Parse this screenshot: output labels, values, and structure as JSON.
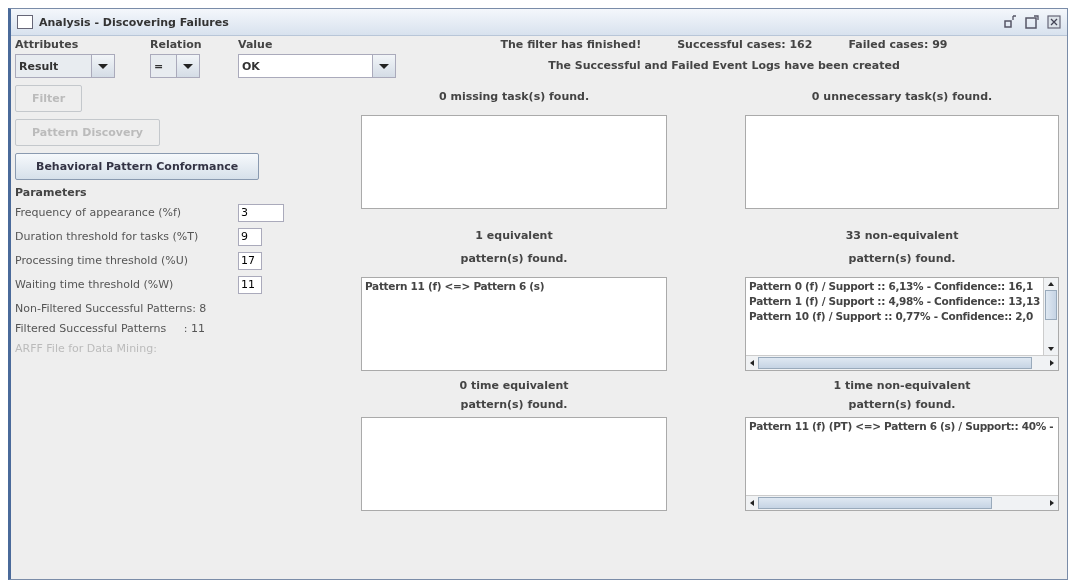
{
  "window": {
    "title": "Analysis - Discovering Failures"
  },
  "filter": {
    "columns": [
      "Attributes",
      "Relation",
      "Value"
    ],
    "dropdowns": [
      {
        "kind": "attribute",
        "value": "Result"
      },
      {
        "kind": "relation",
        "value": "="
      },
      {
        "kind": "value",
        "value": "OK"
      }
    ]
  },
  "buttons": [
    {
      "label": "Filter",
      "disabled": true
    },
    {
      "label": "Pattern Discovery",
      "disabled": true
    },
    {
      "label": "Behavioral Pattern Conformance",
      "disabled": false
    }
  ],
  "parameters": {
    "title": "Parameters",
    "fields": [
      {
        "label": "Frequency of appearance (%f)",
        "value": "3",
        "kind": "wide"
      },
      {
        "label": "Duration threshold for tasks (%T)",
        "value": "9",
        "kind": "narrow"
      },
      {
        "label": "Processing time threshold (%U)",
        "value": "17",
        "kind": "narrow"
      },
      {
        "label": "Waiting time threshold (%W)",
        "value": "11",
        "kind": "narrow"
      }
    ],
    "stats": [
      {
        "label": "Non-Filtered Successful Patterns: 8",
        "disabled": false
      },
      {
        "label": "Filtered Successful Patterns     : 11",
        "disabled": false
      },
      {
        "label": "ARFF File for Data Mining:",
        "disabled": true
      }
    ]
  },
  "status": {
    "lines": [
      [
        "The filter has finished!",
        "Successful cases: 162",
        "Failed cases: 99"
      ],
      [
        "The Successful and Failed Event Logs have been created"
      ]
    ]
  },
  "results": [
    {
      "heading": [
        "0 missing task(s) found."
      ],
      "kind": "plain"
    },
    {
      "heading": [
        "0 unnecessary task(s) found."
      ],
      "kind": "plain"
    },
    {
      "heading": [
        "1 equivalent",
        "pattern(s) found."
      ],
      "items": [
        "Pattern 11 (f) <=> Pattern 6 (s)"
      ],
      "kind": "plain"
    },
    {
      "heading": [
        "33 non-equivalent",
        "pattern(s) found."
      ],
      "items": [
        "Pattern 0 (f) / Support :: 6,13% - Confidence:: 16,1",
        "Pattern 1 (f) / Support :: 4,98% - Confidence:: 13,13",
        "Pattern 10 (f) / Support :: 0,77% - Confidence:: 2,0"
      ],
      "kind": "scrollable"
    },
    {
      "heading": [
        "0 time equivalent",
        "pattern(s) found."
      ],
      "kind": "plain"
    },
    {
      "heading": [
        "1 time non-equivalent",
        "pattern(s) found."
      ],
      "items": [
        "Pattern 11 (f)  (PT) <=> Pattern 6 (s)  / Support:: 40% -"
      ],
      "kind": "wide"
    }
  ]
}
